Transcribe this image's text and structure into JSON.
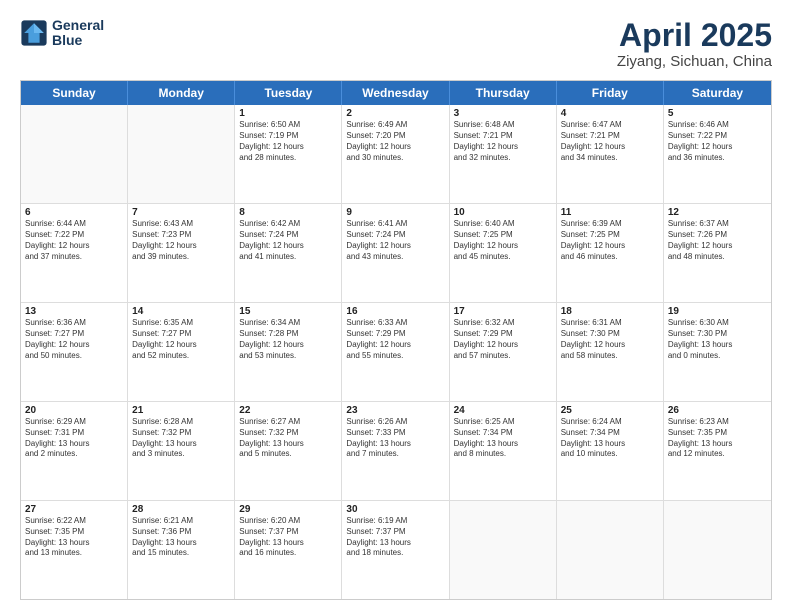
{
  "header": {
    "logo_line1": "General",
    "logo_line2": "Blue",
    "title": "April 2025",
    "subtitle": "Ziyang, Sichuan, China"
  },
  "calendar": {
    "days": [
      "Sunday",
      "Monday",
      "Tuesday",
      "Wednesday",
      "Thursday",
      "Friday",
      "Saturday"
    ],
    "rows": [
      [
        {
          "day": "",
          "text": ""
        },
        {
          "day": "",
          "text": ""
        },
        {
          "day": "1",
          "text": "Sunrise: 6:50 AM\nSunset: 7:19 PM\nDaylight: 12 hours\nand 28 minutes."
        },
        {
          "day": "2",
          "text": "Sunrise: 6:49 AM\nSunset: 7:20 PM\nDaylight: 12 hours\nand 30 minutes."
        },
        {
          "day": "3",
          "text": "Sunrise: 6:48 AM\nSunset: 7:21 PM\nDaylight: 12 hours\nand 32 minutes."
        },
        {
          "day": "4",
          "text": "Sunrise: 6:47 AM\nSunset: 7:21 PM\nDaylight: 12 hours\nand 34 minutes."
        },
        {
          "day": "5",
          "text": "Sunrise: 6:46 AM\nSunset: 7:22 PM\nDaylight: 12 hours\nand 36 minutes."
        }
      ],
      [
        {
          "day": "6",
          "text": "Sunrise: 6:44 AM\nSunset: 7:22 PM\nDaylight: 12 hours\nand 37 minutes."
        },
        {
          "day": "7",
          "text": "Sunrise: 6:43 AM\nSunset: 7:23 PM\nDaylight: 12 hours\nand 39 minutes."
        },
        {
          "day": "8",
          "text": "Sunrise: 6:42 AM\nSunset: 7:24 PM\nDaylight: 12 hours\nand 41 minutes."
        },
        {
          "day": "9",
          "text": "Sunrise: 6:41 AM\nSunset: 7:24 PM\nDaylight: 12 hours\nand 43 minutes."
        },
        {
          "day": "10",
          "text": "Sunrise: 6:40 AM\nSunset: 7:25 PM\nDaylight: 12 hours\nand 45 minutes."
        },
        {
          "day": "11",
          "text": "Sunrise: 6:39 AM\nSunset: 7:25 PM\nDaylight: 12 hours\nand 46 minutes."
        },
        {
          "day": "12",
          "text": "Sunrise: 6:37 AM\nSunset: 7:26 PM\nDaylight: 12 hours\nand 48 minutes."
        }
      ],
      [
        {
          "day": "13",
          "text": "Sunrise: 6:36 AM\nSunset: 7:27 PM\nDaylight: 12 hours\nand 50 minutes."
        },
        {
          "day": "14",
          "text": "Sunrise: 6:35 AM\nSunset: 7:27 PM\nDaylight: 12 hours\nand 52 minutes."
        },
        {
          "day": "15",
          "text": "Sunrise: 6:34 AM\nSunset: 7:28 PM\nDaylight: 12 hours\nand 53 minutes."
        },
        {
          "day": "16",
          "text": "Sunrise: 6:33 AM\nSunset: 7:29 PM\nDaylight: 12 hours\nand 55 minutes."
        },
        {
          "day": "17",
          "text": "Sunrise: 6:32 AM\nSunset: 7:29 PM\nDaylight: 12 hours\nand 57 minutes."
        },
        {
          "day": "18",
          "text": "Sunrise: 6:31 AM\nSunset: 7:30 PM\nDaylight: 12 hours\nand 58 minutes."
        },
        {
          "day": "19",
          "text": "Sunrise: 6:30 AM\nSunset: 7:30 PM\nDaylight: 13 hours\nand 0 minutes."
        }
      ],
      [
        {
          "day": "20",
          "text": "Sunrise: 6:29 AM\nSunset: 7:31 PM\nDaylight: 13 hours\nand 2 minutes."
        },
        {
          "day": "21",
          "text": "Sunrise: 6:28 AM\nSunset: 7:32 PM\nDaylight: 13 hours\nand 3 minutes."
        },
        {
          "day": "22",
          "text": "Sunrise: 6:27 AM\nSunset: 7:32 PM\nDaylight: 13 hours\nand 5 minutes."
        },
        {
          "day": "23",
          "text": "Sunrise: 6:26 AM\nSunset: 7:33 PM\nDaylight: 13 hours\nand 7 minutes."
        },
        {
          "day": "24",
          "text": "Sunrise: 6:25 AM\nSunset: 7:34 PM\nDaylight: 13 hours\nand 8 minutes."
        },
        {
          "day": "25",
          "text": "Sunrise: 6:24 AM\nSunset: 7:34 PM\nDaylight: 13 hours\nand 10 minutes."
        },
        {
          "day": "26",
          "text": "Sunrise: 6:23 AM\nSunset: 7:35 PM\nDaylight: 13 hours\nand 12 minutes."
        }
      ],
      [
        {
          "day": "27",
          "text": "Sunrise: 6:22 AM\nSunset: 7:35 PM\nDaylight: 13 hours\nand 13 minutes."
        },
        {
          "day": "28",
          "text": "Sunrise: 6:21 AM\nSunset: 7:36 PM\nDaylight: 13 hours\nand 15 minutes."
        },
        {
          "day": "29",
          "text": "Sunrise: 6:20 AM\nSunset: 7:37 PM\nDaylight: 13 hours\nand 16 minutes."
        },
        {
          "day": "30",
          "text": "Sunrise: 6:19 AM\nSunset: 7:37 PM\nDaylight: 13 hours\nand 18 minutes."
        },
        {
          "day": "",
          "text": ""
        },
        {
          "day": "",
          "text": ""
        },
        {
          "day": "",
          "text": ""
        }
      ]
    ]
  }
}
